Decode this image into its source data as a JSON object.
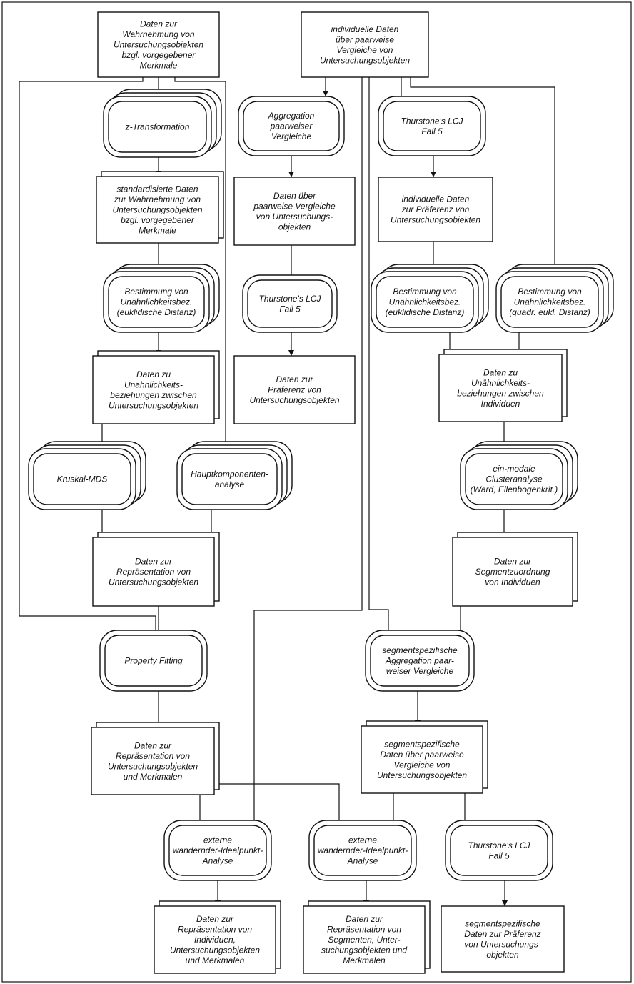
{
  "colors": {
    "line": "#111111",
    "background": "#ffffff"
  },
  "nodes": {
    "n1": {
      "lines": [
        "Daten zur",
        "Wahrnehmung von",
        "Untersuchungsobjekten",
        "bzgl. vorgegebener",
        "Merkmale"
      ]
    },
    "n2": {
      "lines": [
        "individuelle Daten",
        "über paarweise",
        "Vergleiche von",
        "Untersuchungsobjekten"
      ]
    },
    "p1": {
      "lines": [
        "z-Transformation"
      ]
    },
    "p2": {
      "lines": [
        "Aggregation",
        "paarweiser",
        "Vergleiche"
      ]
    },
    "p3": {
      "lines": [
        "Thurstone's LCJ",
        "Fall 5"
      ]
    },
    "d3": {
      "lines": [
        "standardisierte Daten",
        "zur Wahrnehmung von",
        "Untersuchungsobjekten",
        "bzgl. vorgegebener",
        "Merkmale"
      ]
    },
    "d4": {
      "lines": [
        "Daten über",
        "paarweise Vergleiche",
        "von Untersuchungs-",
        "objekten"
      ]
    },
    "d5": {
      "lines": [
        "individuelle Daten",
        "zur Präferenz von",
        "Untersuchungsobjekten"
      ]
    },
    "p4": {
      "lines": [
        "Bestimmung von",
        "Unähnlichkeitsbez.",
        "(euklidische Distanz)"
      ]
    },
    "p5": {
      "lines": [
        "Thurstone's LCJ",
        "Fall 5"
      ]
    },
    "p6": {
      "lines": [
        "Bestimmung von",
        "Unähnlichkeitsbez.",
        "(euklidische Distanz)"
      ]
    },
    "p7": {
      "lines": [
        "Bestimmung von",
        "Unähnlichkeitsbez.",
        "(quadr. eukl. Distanz)"
      ]
    },
    "d6": {
      "lines": [
        "Daten zu",
        "Unähnlichkeits-",
        "beziehungen zwischen",
        "Untersuchungsobjekten"
      ]
    },
    "d7": {
      "lines": [
        "Daten zur",
        "Präferenz von",
        "Untersuchungsobjekten"
      ]
    },
    "d8": {
      "lines": [
        "Daten zu",
        "Unähnlichkeits-",
        "beziehungen zwischen",
        "Individuen"
      ]
    },
    "p8": {
      "lines": [
        "Kruskal-MDS"
      ]
    },
    "p9": {
      "lines": [
        "Hauptkomponenten-",
        "analyse"
      ]
    },
    "p10": {
      "lines": [
        "ein-modale",
        "Clusteranalyse",
        "(Ward, Ellenbogenkrit.)"
      ]
    },
    "d9": {
      "lines": [
        "Daten zur",
        "Repräsentation von",
        "Untersuchungsobjekten"
      ]
    },
    "d10": {
      "lines": [
        "Daten zur",
        "Segmentzuordnung",
        "von Individuen"
      ]
    },
    "p11": {
      "lines": [
        "Property Fitting"
      ]
    },
    "p12": {
      "lines": [
        "segmentspezifische",
        "Aggregation paar-",
        "weiser Vergleiche"
      ]
    },
    "d11": {
      "lines": [
        "Daten zur",
        "Repräsentation von",
        "Untersuchungsobjekten",
        "und Merkmalen"
      ]
    },
    "d12": {
      "lines": [
        "segmentspezifische",
        "Daten über paarweise",
        "Vergleiche von",
        "Untersuchungsobjekten"
      ]
    },
    "p13": {
      "lines": [
        "externe",
        "wandernder-Idealpunkt-",
        "Analyse"
      ]
    },
    "p14": {
      "lines": [
        "externe",
        "wandernder-Idealpunkt-",
        "Analyse"
      ]
    },
    "p15": {
      "lines": [
        "Thurstone's LCJ",
        "Fall 5"
      ]
    },
    "d13": {
      "lines": [
        "Daten zur",
        "Repräsentation von",
        "Individuen,",
        "Untersuchungsobjekten",
        "und Merkmalen"
      ]
    },
    "d14": {
      "lines": [
        "Daten zur",
        "Repräsentation von",
        "Segmenten, Unter-",
        "suchungsobjekten und",
        "Merkmalen"
      ]
    },
    "d15": {
      "lines": [
        "segmentspezifische",
        "Daten zur Präferenz",
        "von Untersuchungs-",
        "objekten"
      ]
    }
  }
}
